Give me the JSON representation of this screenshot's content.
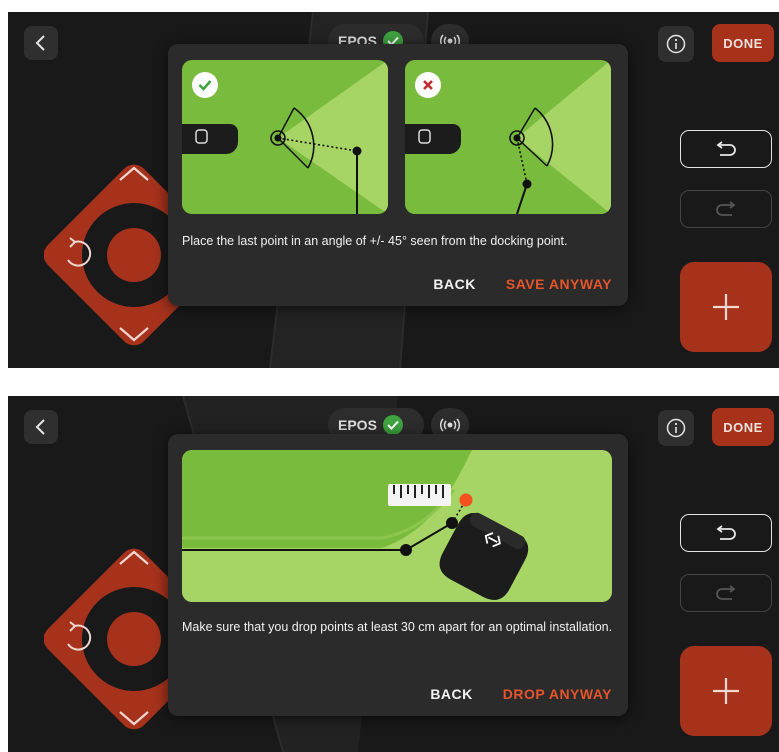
{
  "colors": {
    "accent": "#a6321c",
    "action": "#e5542a",
    "grass": "#79bb3d",
    "grass_light": "#a6d465",
    "ok": "#3fa33f",
    "error": "#c32b32"
  },
  "screens": [
    {
      "status": {
        "epos_label": "EPOS"
      },
      "header": {
        "done_label": "DONE",
        "back_icon": "chevron-left-icon",
        "info_icon": "info-icon"
      },
      "dialog": {
        "message": "Place the last point in an angle of +/- 45° seen from the docking point.",
        "back_label": "BACK",
        "confirm_label": "SAVE ANYWAY",
        "illustrations": [
          "correct-angle",
          "incorrect-angle"
        ]
      }
    },
    {
      "status": {
        "epos_label": "EPOS"
      },
      "header": {
        "done_label": "DONE",
        "back_icon": "chevron-left-icon",
        "info_icon": "info-icon"
      },
      "dialog": {
        "message": "Make sure that you drop points at least 30 cm apart for an optimal installation.",
        "back_label": "BACK",
        "confirm_label": "DROP ANYWAY",
        "illustrations": [
          "point-distance"
        ]
      }
    }
  ]
}
